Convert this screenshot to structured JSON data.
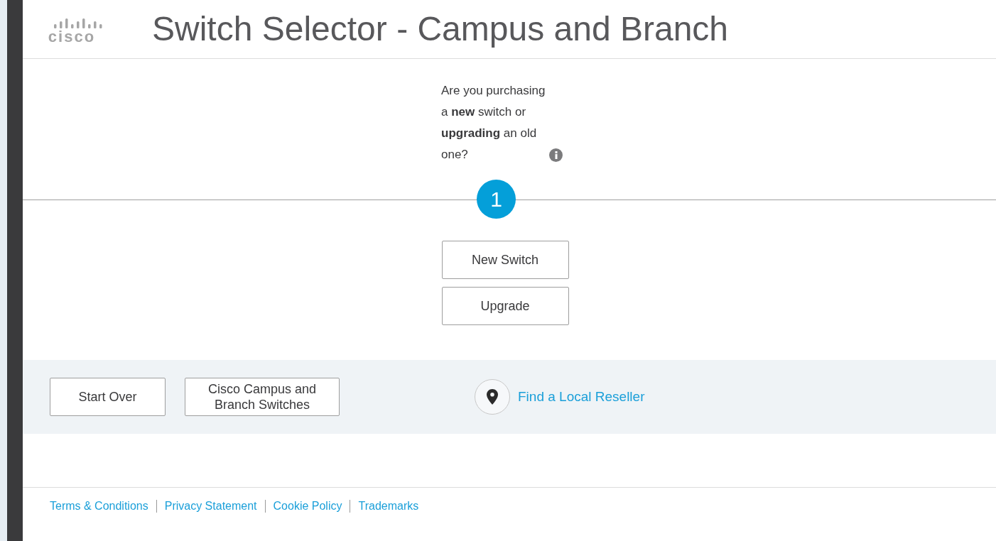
{
  "header": {
    "logo_text": "cisco",
    "title": "Switch Selector - Campus and Branch"
  },
  "question": {
    "text": "Are you purchasing a **new** switch or **upgrading** an old one?",
    "step": "1"
  },
  "choices": [
    {
      "label": "New Switch"
    },
    {
      "label": "Upgrade"
    }
  ],
  "action_bar": {
    "buttons": [
      {
        "label": "Start Over"
      },
      {
        "label": "Cisco Campus and Branch Switches"
      }
    ],
    "reseller_link": "Find a Local Reseller"
  },
  "footer_links": [
    "Terms & Conditions",
    "Privacy Statement",
    "Cookie Policy",
    "Trademarks"
  ]
}
